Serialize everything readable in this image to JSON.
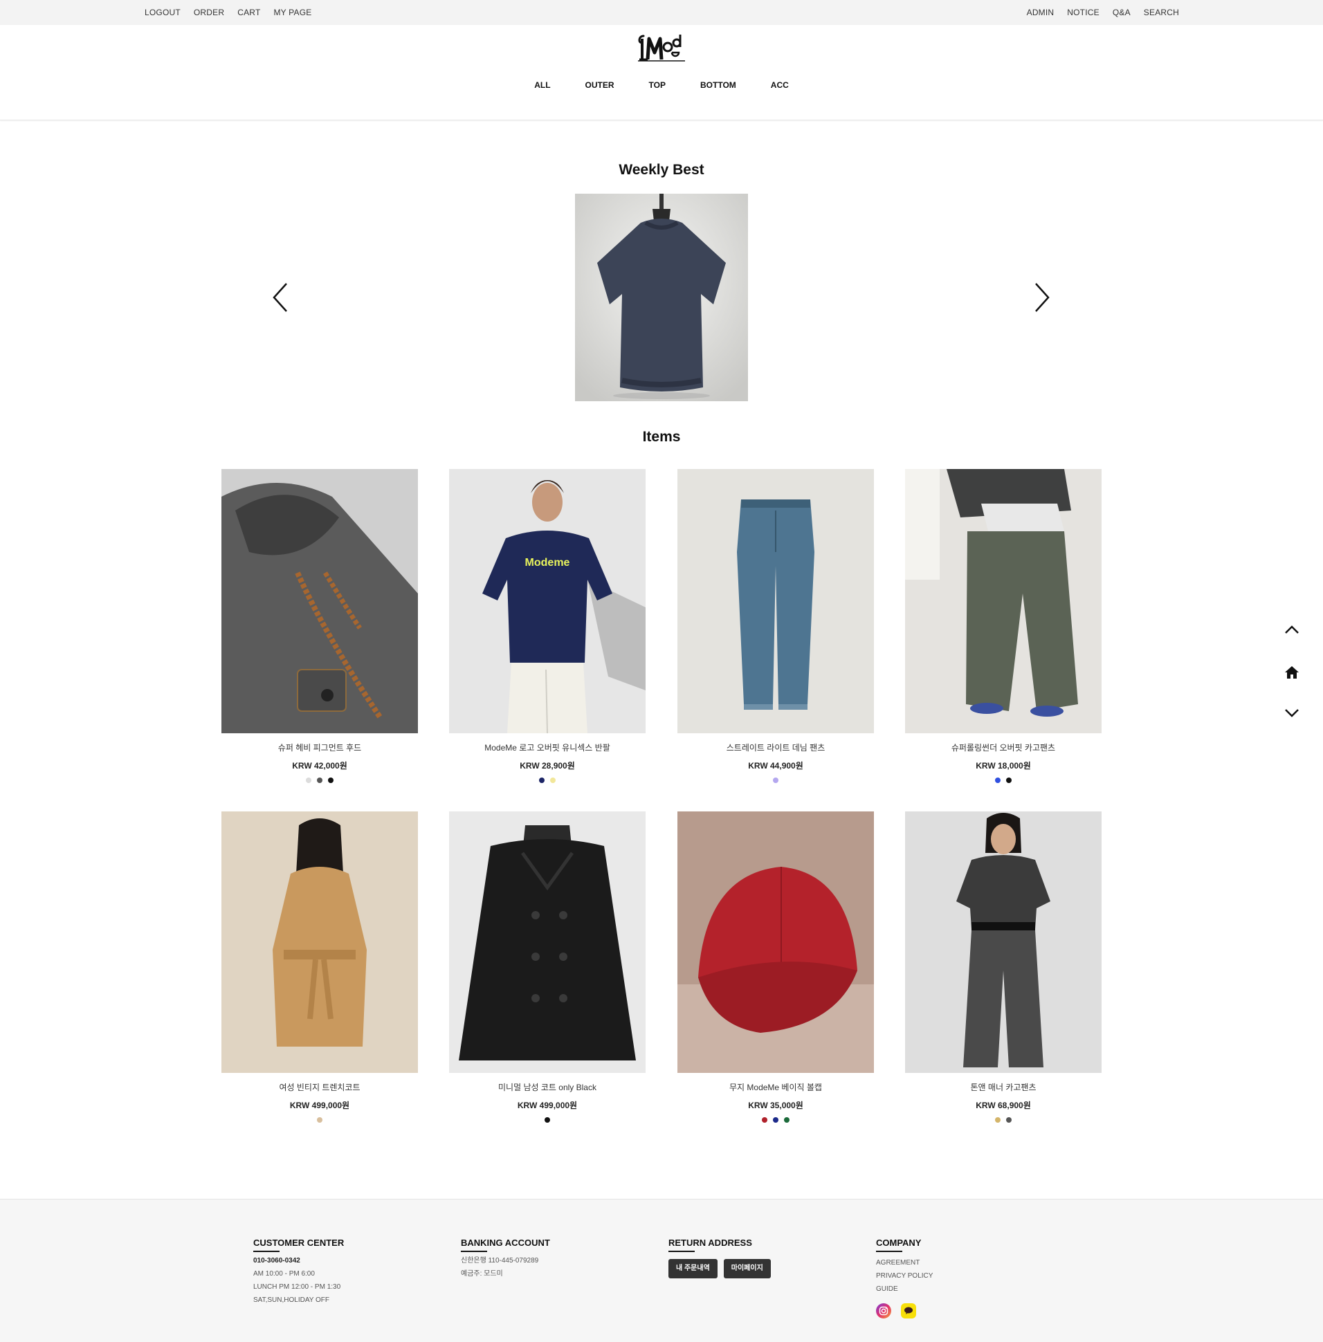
{
  "topbar": {
    "left_links": [
      "LOGOUT",
      "ORDER",
      "CART",
      "MY PAGE"
    ],
    "right_links": [
      "ADMIN",
      "NOTICE",
      "Q&A",
      "SEARCH"
    ]
  },
  "logo": {
    "text": "Mode"
  },
  "nav": [
    "ALL",
    "OUTER",
    "TOP",
    "BOTTOM",
    "ACC"
  ],
  "weekly_best": {
    "title": "Weekly Best"
  },
  "items": {
    "title": "Items",
    "products": [
      {
        "name": "슈퍼 헤비 피그먼트 후드",
        "price": "KRW 42,000원",
        "colors": [
          "#dcdcdc",
          "#555555",
          "#111111"
        ]
      },
      {
        "name": "ModeMe 로고 오버핏 유니섹스 반팔",
        "price": "KRW 28,900원",
        "colors": [
          "#1c2566",
          "#f2e79a"
        ]
      },
      {
        "name": "스트레이트 라이트 데님 팬츠",
        "price": "KRW 44,900원",
        "colors": [
          "#b4a7ef"
        ]
      },
      {
        "name": "슈퍼롤링썬더 오버핏 카고팬츠",
        "price": "KRW 18,000원",
        "colors": [
          "#3050e0",
          "#111111"
        ]
      },
      {
        "name": "여성 빈티지 트렌치코트",
        "price": "KRW 499,000원",
        "colors": [
          "#d8bf9d"
        ]
      },
      {
        "name": "미니멀 남성 코트 only Black",
        "price": "KRW 499,000원",
        "colors": [
          "#111111"
        ]
      },
      {
        "name": "무지 ModeMe 베이직 볼캡",
        "price": "KRW 35,000원",
        "colors": [
          "#b0212b",
          "#1c2a8a",
          "#1b6a3a"
        ]
      },
      {
        "name": "톤앤 매너 카고팬츠",
        "price": "KRW 68,900원",
        "colors": [
          "#d4b56a",
          "#555555"
        ]
      }
    ]
  },
  "footer": {
    "customer_center": {
      "title": "CUSTOMER CENTER",
      "phone": "010-3060-0342",
      "lines": [
        "AM 10:00 - PM 6:00",
        "LUNCH PM 12:00 - PM 1:30",
        "SAT,SUN,HOLIDAY OFF"
      ]
    },
    "banking": {
      "title": "BANKING ACCOUNT",
      "lines": [
        "신한은행 110-445-079289",
        "예금주: 모드미"
      ]
    },
    "return": {
      "title": "RETURN ADDRESS",
      "buttons": [
        "내 주문내역",
        "마이페이지"
      ]
    },
    "company": {
      "title": "COMPANY",
      "links": [
        "AGREEMENT",
        "PRIVACY POLICY",
        "GUIDE"
      ]
    }
  },
  "icons": {
    "slider_prev": "chevron-left-icon",
    "slider_next": "chevron-right-icon",
    "scroll_top": "chevron-up-icon",
    "home": "home-icon",
    "scroll_bottom": "chevron-down-icon",
    "instagram": "instagram-icon",
    "kakaotalk": "kakaotalk-icon"
  }
}
